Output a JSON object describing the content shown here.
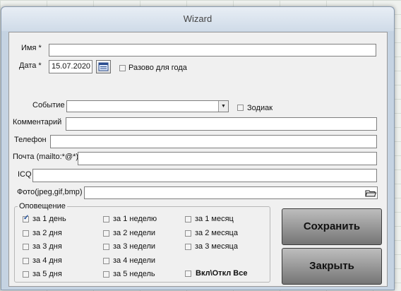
{
  "window": {
    "title": "Wizard"
  },
  "form": {
    "name_label": "Имя *",
    "name_value": "",
    "date_label": "Дата *",
    "date_value": "15.07.2020",
    "once_label": "Разово для года",
    "event_label": "Событие",
    "event_value": "",
    "zodiac_label": "Зодиак",
    "comment_label": "Комментарий",
    "comment_value": "",
    "phone_label": "Телефон",
    "phone_value": "",
    "email_label": "Почта (mailto:*@*)",
    "email_value": "",
    "icq_label": "ICQ",
    "icq_value": "",
    "photo_label": "Фото(jpeg,gif,bmp)",
    "photo_value": ""
  },
  "notify": {
    "title": "Оповещение",
    "col1": [
      "за 1 день",
      "за 2 дня",
      "за 3 дня",
      "за 4 дня",
      "за 5 дня"
    ],
    "col2": [
      "за 1 неделю",
      "за 2 недели",
      "за 3 недели",
      "за 4 недели",
      "за 5 недель"
    ],
    "col3": [
      "за 1 месяц",
      "за 2 месяца",
      "за 3 месяца"
    ],
    "toggle_all": "Вкл\\Откл Все",
    "checked": [
      "за 1 день"
    ]
  },
  "buttons": {
    "save": "Сохранить",
    "close": "Закрыть"
  }
}
